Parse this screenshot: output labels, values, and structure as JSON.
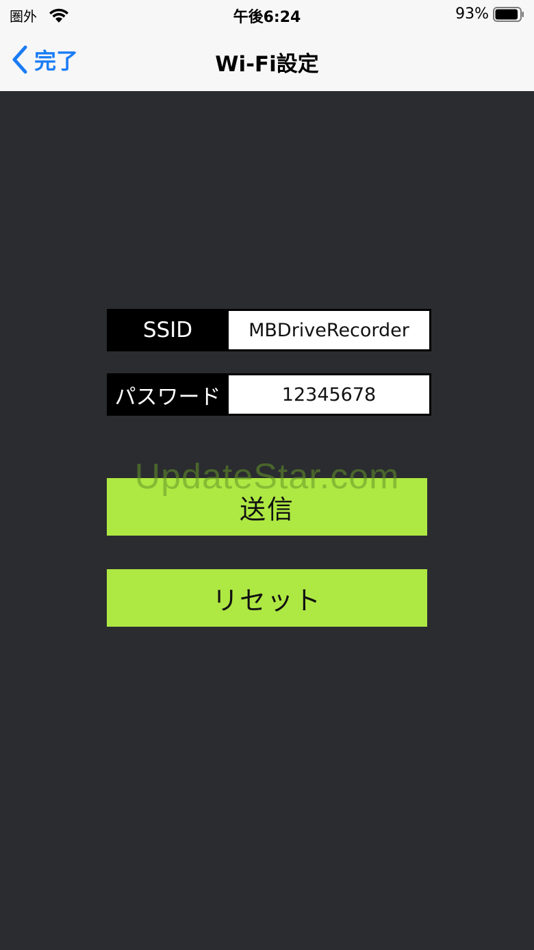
{
  "status_bar": {
    "carrier": "圏外",
    "time": "午後6:24",
    "battery_percent": "93%",
    "battery_level": 0.93
  },
  "nav": {
    "back_label": "完了",
    "title": "Wi-Fi設定"
  },
  "form": {
    "ssid_label": "SSID",
    "ssid_value": "MBDriveRecorder",
    "password_label": "パスワード",
    "password_value": "12345678"
  },
  "buttons": {
    "send": "送信",
    "reset": "リセット"
  },
  "watermark": "UpdateStar.com",
  "colors": {
    "background": "#2a2c30",
    "accent": "#1a7cf5",
    "button": "#aee843"
  }
}
